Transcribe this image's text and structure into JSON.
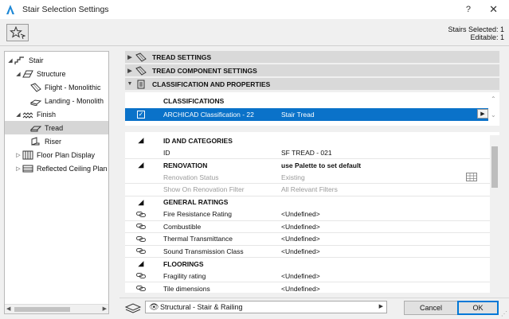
{
  "window": {
    "title": "Stair Selection Settings",
    "help_label": "?",
    "close_label": "✕"
  },
  "toolbar": {
    "stairs_selected": "Stairs Selected: 1",
    "editable": "Editable: 1"
  },
  "tree": [
    {
      "label": "Stair",
      "arrow": "◢",
      "icon": "stair-icon"
    },
    {
      "label": "Structure",
      "arrow": "◢",
      "icon": "structure-icon"
    },
    {
      "label": "Flight - Monolithic",
      "arrow": "",
      "icon": "flight-icon"
    },
    {
      "label": "Landing - Monolith",
      "arrow": "",
      "icon": "landing-icon"
    },
    {
      "label": "Finish",
      "arrow": "◢",
      "icon": "finish-icon"
    },
    {
      "label": "Tread",
      "arrow": "",
      "icon": "tread-icon",
      "selected": true
    },
    {
      "label": "Riser",
      "arrow": "",
      "icon": "riser-icon"
    },
    {
      "label": "Floor Plan Display",
      "arrow": "▷",
      "icon": "floor-plan-icon"
    },
    {
      "label": "Reflected Ceiling Plan",
      "arrow": "▷",
      "icon": "ceiling-plan-icon"
    }
  ],
  "panels": [
    {
      "label": "TREAD SETTINGS",
      "arrow": "▶"
    },
    {
      "label": "TREAD COMPONENT SETTINGS",
      "arrow": "▶"
    },
    {
      "label": "CLASSIFICATION AND PROPERTIES",
      "arrow": "▼"
    }
  ],
  "classifications": {
    "header": "CLASSIFICATIONS",
    "row": {
      "name": "ARCHICAD Classification - 22",
      "value": "Stair Tread",
      "checked": true
    }
  },
  "properties": [
    {
      "type": "group",
      "name": "ID AND CATEGORIES"
    },
    {
      "type": "item",
      "name": "ID",
      "value": "SF TREAD - 021",
      "icon": ""
    },
    {
      "type": "group",
      "name": "RENOVATION",
      "value": "use Palette to set default"
    },
    {
      "type": "dim",
      "name": "Renovation Status",
      "value": "Existing"
    },
    {
      "type": "dim",
      "name": "Show On Renovation Filter",
      "value": "All Relevant Filters"
    },
    {
      "type": "group",
      "name": "GENERAL RATINGS"
    },
    {
      "type": "item",
      "name": "Fire Resistance Rating",
      "value": "<Undefined>",
      "icon": "link"
    },
    {
      "type": "item",
      "name": "Combustible",
      "value": "<Undefined>",
      "icon": "link"
    },
    {
      "type": "item",
      "name": "Thermal Transmittance",
      "value": "<Undefined>",
      "icon": "link"
    },
    {
      "type": "item",
      "name": "Sound Transmission Class",
      "value": "<Undefined>",
      "icon": "link"
    },
    {
      "type": "group",
      "name": "FLOORINGS"
    },
    {
      "type": "item",
      "name": "Fragility rating",
      "value": "<Undefined>",
      "icon": "link"
    },
    {
      "type": "item",
      "name": "Tile dimensions",
      "value": "<Undefined>",
      "icon": "link"
    }
  ],
  "bottom": {
    "layer": "Structural - Stair & Railing",
    "cancel_label": "Cancel",
    "ok_label": "OK"
  },
  "colors": {
    "selection": "#0a72c9",
    "ok_border": "#0078d7"
  }
}
